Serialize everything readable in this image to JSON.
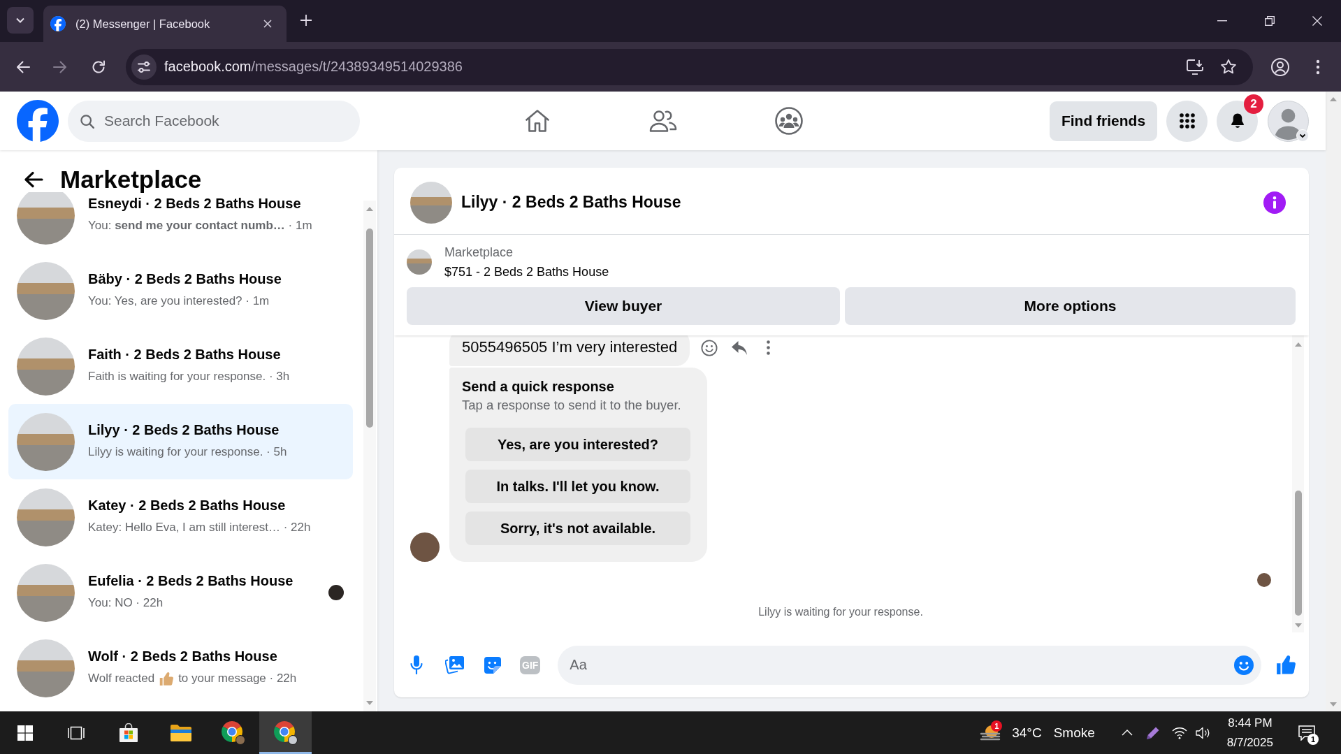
{
  "browser": {
    "tabs": [
      {
        "title": "(2) Messenger | Facebook",
        "selected": true
      }
    ],
    "address": {
      "host": "facebook.com",
      "path": "/messages/t/24389349514029386"
    }
  },
  "header": {
    "search": {
      "placeholder": "Search Facebook"
    },
    "find_friends": "Find friends",
    "notification_count": "2"
  },
  "sidebar": {
    "title": "Marketplace",
    "conversations": [
      {
        "kind": "message",
        "name": "Esneydi · 2 Beds 2 Baths House",
        "preview": "You: **send me your contact numb…** · 1m",
        "selected": false,
        "seen": false
      },
      {
        "kind": "message",
        "name": "Bäby · 2 Beds 2 Baths House",
        "preview": "You: Yes, are you interested? · 1m",
        "selected": false,
        "seen": false
      },
      {
        "kind": "message",
        "name": "Faith · 2 Beds 2 Baths House",
        "preview": "Faith is waiting for your response. · 3h",
        "selected": false,
        "seen": false
      },
      {
        "kind": "message",
        "name": "Lilyy · 2 Beds 2 Baths House",
        "preview": "Lilyy is waiting for your response. · 5h",
        "selected": true,
        "seen": false
      },
      {
        "kind": "message",
        "name": "Katey · 2 Beds 2 Baths House",
        "preview": "Katey: Hello Eva, I am still interest… · 22h",
        "selected": false,
        "seen": false
      },
      {
        "kind": "message",
        "name": "Eufelia · 2 Beds 2 Baths House",
        "preview": "You: NO · 22h",
        "selected": false,
        "seen": true
      },
      {
        "kind": "reaction",
        "name": "Wolf · 2 Beds 2 Baths House",
        "preview": "Wolf reacted",
        "preview_after": "to your message · 22h",
        "selected": false,
        "seen": false
      }
    ]
  },
  "chat": {
    "title": "Lilyy · 2 Beds 2 Baths House",
    "listing": {
      "label": "Marketplace",
      "title": "$751 - 2 Beds 2 Baths House"
    },
    "actions": [
      "View buyer",
      "More options"
    ],
    "messages": [
      {
        "kind": "text",
        "text": "5055496505 I’m very interested"
      },
      {
        "kind": "quick_responses",
        "title": "Send a quick response",
        "subtitle": "Tap a response to send it to the buyer.",
        "options": [
          "Yes, are you interested?",
          "In talks. I'll let you know.",
          "Sorry, it's not available."
        ]
      }
    ],
    "status": "Lilyy is waiting for your response.",
    "composer": {
      "placeholder": "Aa",
      "gif_label": "GIF"
    }
  },
  "taskbar": {
    "apps": [
      {
        "kind": "task-view",
        "selected": false
      },
      {
        "kind": "store",
        "selected": false
      },
      {
        "kind": "files",
        "selected": false
      },
      {
        "kind": "chrome",
        "selected": false
      },
      {
        "kind": "chrome-profile",
        "selected": true
      }
    ],
    "weather": {
      "temperature": "34°C",
      "condition": "Smoke",
      "alert_count": "1"
    },
    "clock": {
      "time": "8:44 PM",
      "date": "8/7/2025"
    },
    "notification_count": "1"
  }
}
